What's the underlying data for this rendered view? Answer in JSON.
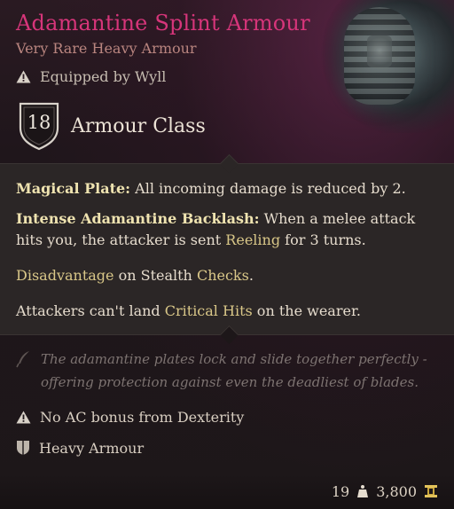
{
  "item": {
    "name": "Adamantine Splint Armour",
    "rarity_type": "Very Rare Heavy Armour",
    "equipped_by": "Equipped by Wyll",
    "armour_class_value": "18",
    "armour_class_label": "Armour Class"
  },
  "effects": {
    "magical_plate": {
      "name": "Magical Plate:",
      "text": " All incoming damage is reduced by 2."
    },
    "backlash": {
      "name": "Intense Adamantine Backlash:",
      "text_before": " When a melee attack hits you, the attacker is sent ",
      "keyword": "Reeling",
      "text_after": " for 3 turns."
    },
    "stealth": {
      "keyword1": "Disadvantage",
      "mid": " on Stealth ",
      "keyword2": "Checks",
      "end": "."
    },
    "critical": {
      "before": "Attackers can't land ",
      "keyword": "Critical Hits",
      "after": " on the wearer."
    }
  },
  "flavor_text": "The adamantine plates lock and slide together perfectly - offering protection against even the deadliest of blades.",
  "properties": {
    "dex": "No AC bonus from Dexterity",
    "category": "Heavy Armour"
  },
  "footer": {
    "weight": "19",
    "value": "3,800"
  },
  "colors": {
    "title": "#d6357a",
    "subtitle": "#b9857f",
    "keyword": "#d9c788",
    "effect_name": "#efe3b0",
    "flavor": "#7d7371",
    "panel": "#2b2626"
  },
  "icons": {
    "warning": "warning-triangle-icon",
    "shield": "ac-shield-icon",
    "flavor": "quill-icon",
    "armour": "armour-shield-icon",
    "weight": "weight-icon",
    "gold": "gold-coin-icon"
  }
}
